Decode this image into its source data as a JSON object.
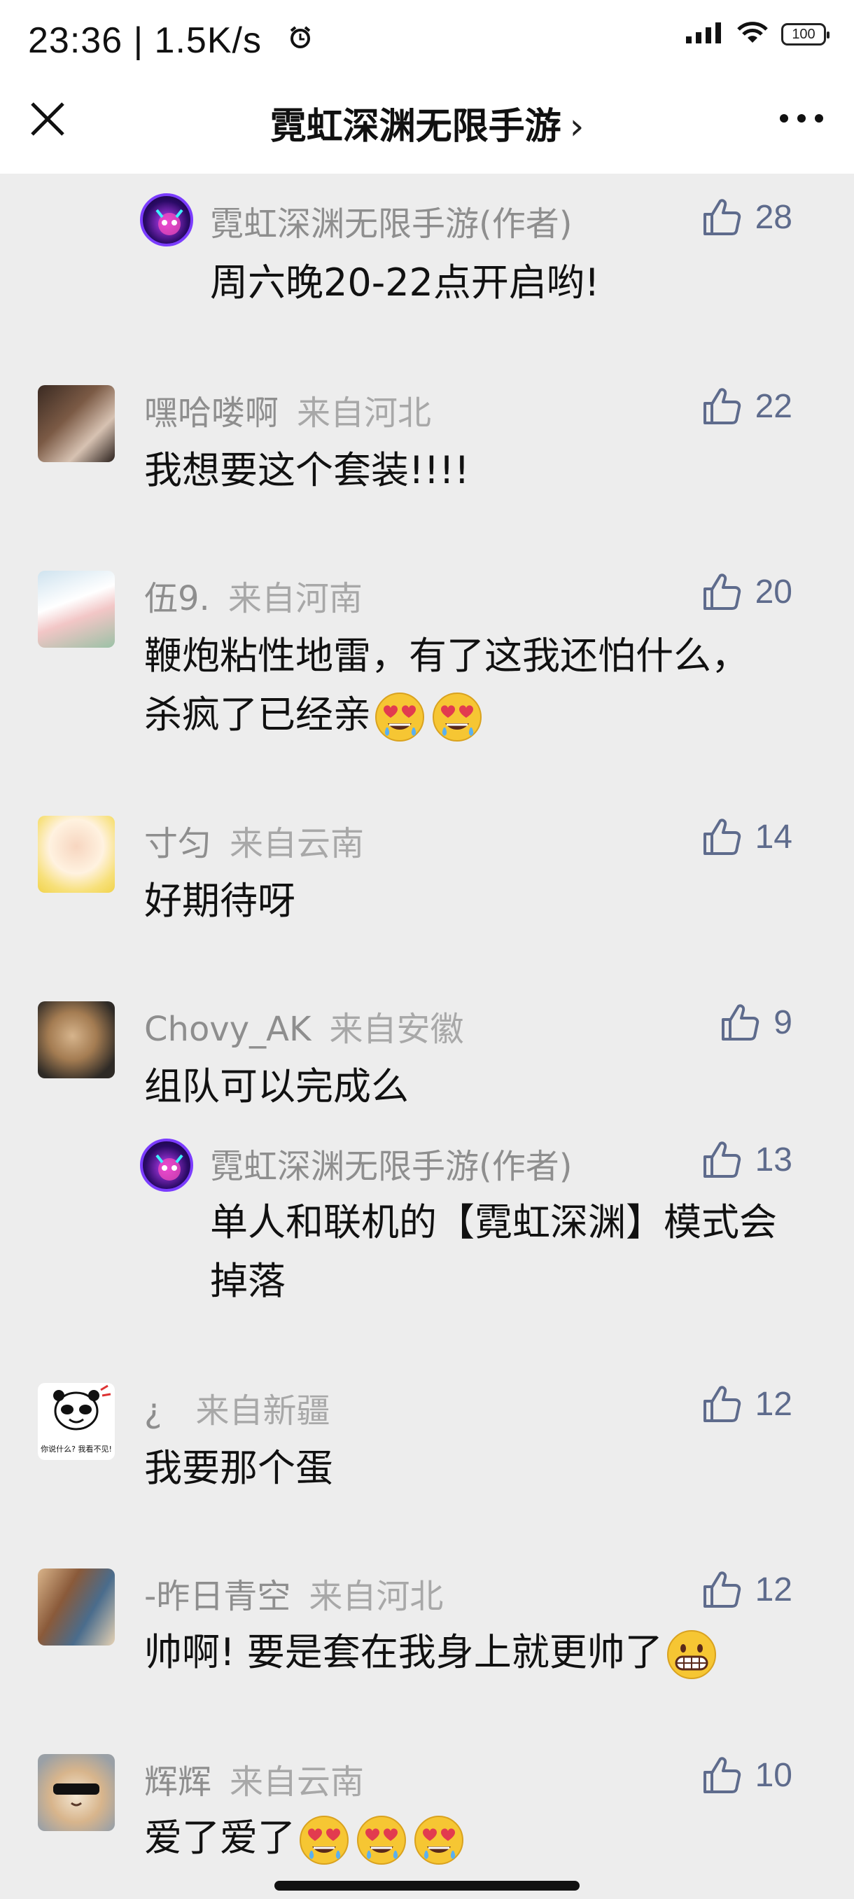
{
  "status": {
    "time": "23:36 | 1.5K/s",
    "battery": "100"
  },
  "nav": {
    "title": "霓虹深渊无限手游",
    "chevron": "›"
  },
  "comments": [
    {
      "name": "霓虹深渊无限手游(作者)",
      "location": "",
      "text": "周六晚20-22点开启哟!",
      "likes": "28"
    },
    {
      "name": "嘿哈喽啊",
      "location": "来自河北",
      "text": "我想要这个套装!!!!",
      "likes": "22"
    },
    {
      "name": "伍9.",
      "location": "来自河南",
      "text": "鞭炮粘性地雷，有了这我还怕什么，杀疯了已经亲",
      "likes": "20"
    },
    {
      "name": "寸匀",
      "location": "来自云南",
      "text": "好期待呀",
      "likes": "14"
    },
    {
      "name": "Chovy_AK",
      "location": "来自安徽",
      "text": "组队可以完成么",
      "likes": "9"
    },
    {
      "name": "霓虹深渊无限手游(作者)",
      "location": "",
      "text": "单人和联机的【霓虹深渊】模式会掉落",
      "likes": "13"
    },
    {
      "name": "¿",
      "location": "来自新疆",
      "text": "我要那个蛋",
      "likes": "12"
    },
    {
      "name": "-昨日青空",
      "location": "来自河北",
      "text": "帅啊! 要是套在我身上就更帅了",
      "likes": "12"
    },
    {
      "name": "辉辉",
      "location": "来自云南",
      "text": "爱了爱了",
      "likes": "10"
    }
  ],
  "avatar7_caption": "你说什么? 我看不见!",
  "colors": {
    "like": "#5e6b8c",
    "background": "#ededed"
  }
}
